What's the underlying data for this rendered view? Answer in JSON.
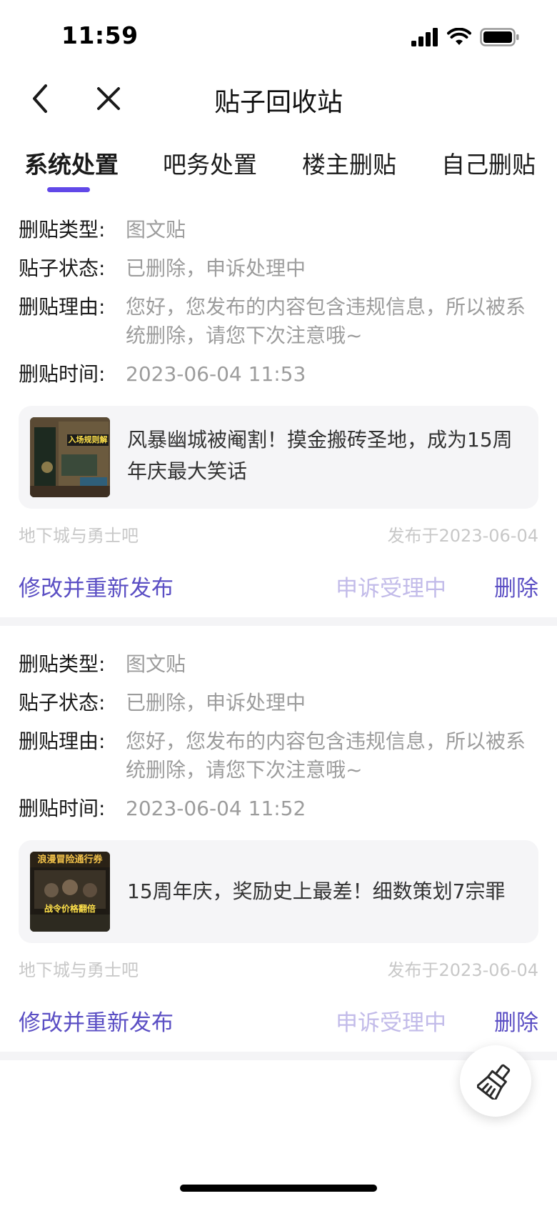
{
  "status_bar": {
    "time": "11:59"
  },
  "nav": {
    "title": "贴子回收站"
  },
  "tabs": [
    {
      "label": "系统处置",
      "active": true
    },
    {
      "label": "吧务处置",
      "active": false
    },
    {
      "label": "楼主删贴",
      "active": false
    },
    {
      "label": "自己删贴",
      "active": false
    }
  ],
  "labels": {
    "type": "删贴类型:",
    "status": "贴子状态:",
    "reason": "删贴理由:",
    "time": "删贴时间:"
  },
  "posts": [
    {
      "type": "图文贴",
      "status": "已删除，申诉处理中",
      "reason": "您好，您发布的内容包含违规信息，所以被系统删除，请您下次注意哦~",
      "time": "2023-06-04 11:53",
      "title": "风暴幽城被阉割！摸金搬砖圣地，成为15周年庆最大笑话",
      "thumb_text": "入场规则解",
      "forum": "地下城与勇士吧",
      "published": "发布于2023-06-04",
      "edit_label": "修改并重新发布",
      "appeal_label": "申诉受理中",
      "delete_label": "删除"
    },
    {
      "type": "图文贴",
      "status": "已删除，申诉处理中",
      "reason": "您好，您发布的内容包含违规信息，所以被系统删除，请您下次注意哦~",
      "time": "2023-06-04 11:52",
      "title": "15周年庆，奖励史上最差！细数策划7宗罪",
      "thumb_text": "浪漫冒险通行券",
      "thumb_text2": "战令价格翻倍",
      "forum": "地下城与勇士吧",
      "published": "发布于2023-06-04",
      "edit_label": "修改并重新发布",
      "appeal_label": "申诉受理中",
      "delete_label": "删除"
    }
  ],
  "colors": {
    "accent": "#6148e8",
    "action": "#5b4fc4",
    "action_disabled": "#c2bbe9",
    "muted_text": "#9c9c9c",
    "meta_text": "#c8c8c8",
    "card_bg": "#f5f5f7"
  },
  "icons": {
    "back": "chevron-left-icon",
    "close": "close-icon",
    "signal": "signal-icon",
    "wifi": "wifi-icon",
    "battery": "battery-icon",
    "fab": "broom-icon"
  }
}
